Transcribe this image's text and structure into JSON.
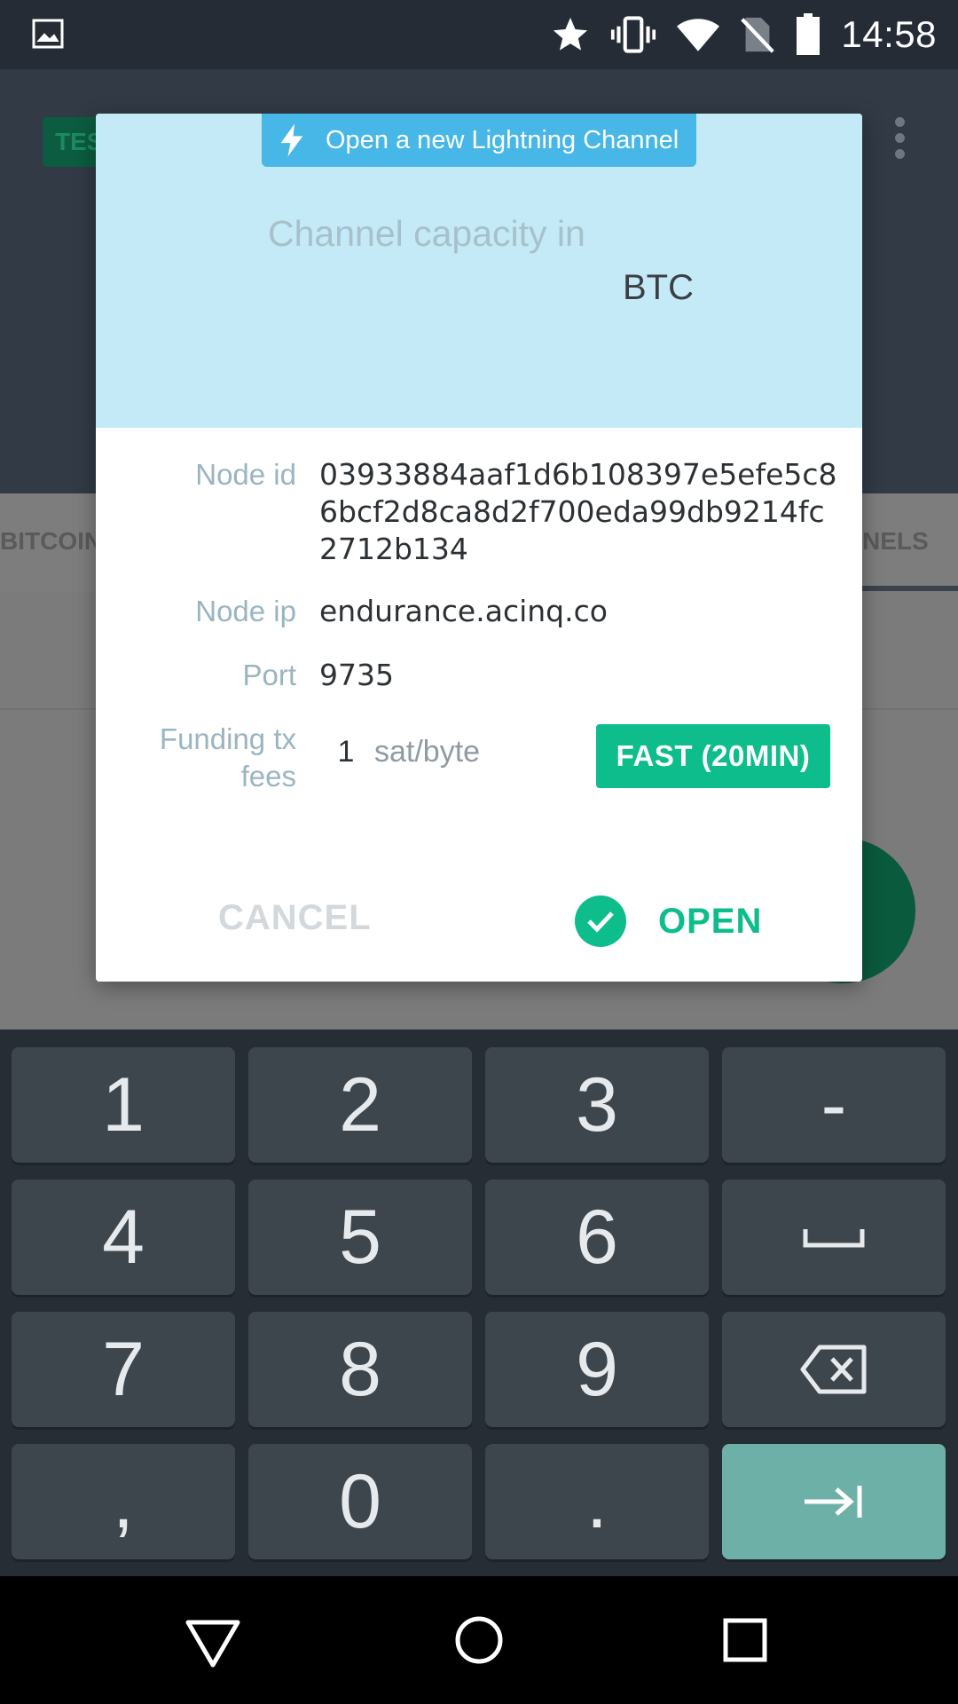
{
  "status_bar": {
    "time": "14:58",
    "icons": [
      "image-icon",
      "star-icon",
      "vibrate-icon",
      "wifi-icon",
      "no-sim-icon",
      "battery-icon"
    ]
  },
  "background": {
    "badge": "TES",
    "tab_left": "BITCOIN",
    "tab_right": "NELS"
  },
  "dialog": {
    "title": "Open a new Lightning Channel",
    "capacity_label": "Channel capacity in",
    "capacity_unit": "BTC",
    "fields": {
      "node_id_label": "Node id",
      "node_id": "03933884aaf1d6b108397e5efe5c86bcf2d8ca8d2f700eda99db9214fc2712b134",
      "node_ip_label": "Node ip",
      "node_ip": "endurance.acinq.co",
      "port_label": "Port",
      "port": "9735",
      "fees_label_line1": "Funding tx",
      "fees_label_line2": "fees",
      "fees_value": "1",
      "fees_unit": "sat/byte",
      "fees_preset": "FAST (20MIN)"
    },
    "cancel_label": "CANCEL",
    "open_label": "OPEN"
  },
  "keyboard": {
    "keys": [
      "1",
      "2",
      "3",
      "-",
      "4",
      "5",
      "6",
      "␣",
      "7",
      "8",
      "9",
      "⌫",
      ",",
      "0",
      ".",
      "⇥"
    ]
  },
  "colors": {
    "accent": "#0dbd8b",
    "header_bg": "#c4e9f7",
    "title_pill": "#46b7e6",
    "keyboard_bg": "#262d34",
    "key_bg": "#3d454d",
    "enter_key": "#6db0a7"
  }
}
